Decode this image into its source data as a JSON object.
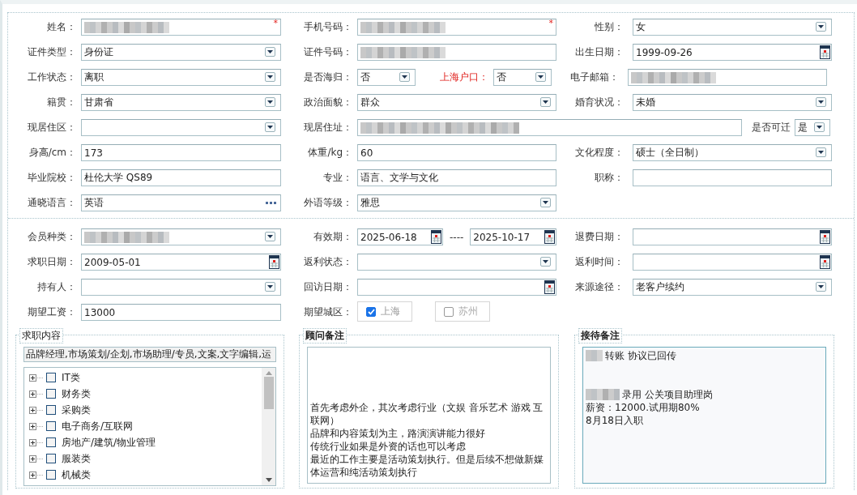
{
  "top_rows": [
    [
      {
        "kind": "field",
        "label": "姓名：",
        "controls": [
          {
            "kind": "text",
            "redacted": true,
            "required_mark": "*"
          }
        ]
      },
      {
        "kind": "field",
        "label": "手机号码：",
        "controls": [
          {
            "kind": "text",
            "redacted": true,
            "required_mark": "*"
          }
        ]
      },
      {
        "kind": "field",
        "label": "性别：",
        "controls": [
          {
            "kind": "select",
            "value": "女"
          }
        ]
      }
    ],
    [
      {
        "kind": "field",
        "label": "证件类型：",
        "controls": [
          {
            "kind": "select",
            "value": "身份证"
          }
        ]
      },
      {
        "kind": "field",
        "label": "证件号码：",
        "controls": [
          {
            "kind": "text",
            "redacted": true
          }
        ]
      },
      {
        "kind": "field",
        "label": "出生日期：",
        "controls": [
          {
            "kind": "date",
            "value": "1999-09-26"
          }
        ]
      }
    ],
    [
      {
        "kind": "field",
        "label": "工作状态：",
        "controls": [
          {
            "kind": "select",
            "value": "离职"
          }
        ]
      },
      {
        "kind": "pair",
        "label": "是否海归：",
        "sublabel": "上海户口：",
        "sublabel_emphasis": true,
        "controls": [
          {
            "kind": "select",
            "value": "否"
          },
          {
            "kind": "select",
            "value": "否"
          }
        ]
      },
      {
        "kind": "field",
        "label": "电子邮箱：",
        "controls": [
          {
            "kind": "text",
            "redacted": true
          }
        ]
      }
    ],
    [
      {
        "kind": "field",
        "label": "籍贯：",
        "controls": [
          {
            "kind": "select",
            "value": "甘肃省"
          }
        ]
      },
      {
        "kind": "field",
        "label": "政治面貌：",
        "controls": [
          {
            "kind": "select",
            "value": "群众"
          }
        ]
      },
      {
        "kind": "field",
        "label": "婚育状况：",
        "controls": [
          {
            "kind": "select",
            "value": "未婚"
          }
        ]
      }
    ],
    [
      {
        "kind": "field",
        "label": "现居住区：",
        "controls": [
          {
            "kind": "select"
          }
        ]
      },
      {
        "kind": "wide",
        "label": "现居住址：",
        "sublabel": "是否可迁",
        "controls": [
          {
            "kind": "text",
            "redacted": true
          },
          {
            "kind": "select",
            "value": "是"
          }
        ]
      }
    ],
    [
      {
        "kind": "field",
        "label": "身高/cm：",
        "controls": [
          {
            "kind": "text",
            "value": "173"
          }
        ]
      },
      {
        "kind": "field",
        "label": "体重/kg：",
        "controls": [
          {
            "kind": "text",
            "value": "60"
          }
        ]
      },
      {
        "kind": "field",
        "label": "文化程度：",
        "controls": [
          {
            "kind": "select",
            "value": "硕士（全日制）"
          }
        ]
      }
    ],
    [
      {
        "kind": "field",
        "label": "毕业院校：",
        "controls": [
          {
            "kind": "text",
            "value": "杜伦大学 QS89"
          }
        ]
      },
      {
        "kind": "field",
        "label": "专业：",
        "controls": [
          {
            "kind": "text",
            "value": "语言、文学与文化"
          }
        ]
      },
      {
        "kind": "field",
        "label": "职称：",
        "controls": [
          {
            "kind": "text"
          }
        ]
      }
    ],
    [
      {
        "kind": "field",
        "label": "通晓语言：",
        "controls": [
          {
            "kind": "lookup",
            "value": "英语"
          }
        ]
      },
      {
        "kind": "field",
        "label": "外语等级：",
        "controls": [
          {
            "kind": "select",
            "value": "雅思"
          }
        ]
      }
    ]
  ],
  "lower_rows": [
    [
      {
        "kind": "field",
        "label": "会员种类：",
        "controls": [
          {
            "kind": "select",
            "redacted": true
          }
        ]
      },
      {
        "kind": "range",
        "label": "有效期：",
        "separator": "----",
        "controls": [
          {
            "kind": "date",
            "value": "2025-06-18"
          },
          {
            "kind": "date",
            "value": "2025-10-17"
          }
        ]
      },
      {
        "kind": "field",
        "label": "退费日期：",
        "controls": [
          {
            "kind": "date"
          }
        ]
      }
    ],
    [
      {
        "kind": "field",
        "label": "求职日期：",
        "controls": [
          {
            "kind": "date",
            "value": "2009-05-01"
          }
        ]
      },
      {
        "kind": "field",
        "label": "返利状态：",
        "controls": [
          {
            "kind": "select"
          }
        ]
      },
      {
        "kind": "field",
        "label": "返利时间：",
        "controls": [
          {
            "kind": "date"
          }
        ]
      }
    ],
    [
      {
        "kind": "field",
        "label": "持有人：",
        "controls": [
          {
            "kind": "select"
          }
        ]
      },
      {
        "kind": "field",
        "label": "回访日期：",
        "controls": [
          {
            "kind": "date"
          }
        ]
      },
      {
        "kind": "field",
        "label": "来源途径：",
        "controls": [
          {
            "kind": "select",
            "value": "老客户续约"
          }
        ]
      }
    ],
    [
      {
        "kind": "field",
        "label": "期望工资：",
        "controls": [
          {
            "kind": "text",
            "value": "13000"
          }
        ]
      },
      {
        "kind": "choices",
        "label": "期望城区：",
        "options": [
          {
            "label": "上海",
            "checked": true
          },
          {
            "label": "苏州",
            "checked": false
          }
        ]
      }
    ]
  ],
  "job_content": {
    "title": "求职内容",
    "summary": "品牌经理,市场策划/企划,市场助理/专员,文案,文字编辑,运",
    "tree": [
      {
        "label": "IT类",
        "expanded": false,
        "checked": false
      },
      {
        "label": "财务类",
        "expanded": false,
        "checked": false
      },
      {
        "label": "采购类",
        "expanded": false,
        "checked": false
      },
      {
        "label": "电子商务/互联网",
        "expanded": false,
        "checked": false
      },
      {
        "label": "房地产/建筑/物业管理",
        "expanded": false,
        "checked": false
      },
      {
        "label": "服装类",
        "expanded": false,
        "checked": false
      },
      {
        "label": "机械类",
        "expanded": false,
        "checked": false
      }
    ]
  },
  "consultant_notes": {
    "title": "顾问备注",
    "lines": [
      {
        "kind": "blank"
      },
      {
        "kind": "blank"
      },
      {
        "kind": "blank"
      },
      {
        "kind": "blank"
      },
      {
        "kind": "text",
        "text": "首先考虑外企，其次考虑行业（文娱  音乐艺术  游戏  互联网）"
      },
      {
        "kind": "text",
        "text": "品牌和内容策划为主，路演演讲能力很好"
      },
      {
        "kind": "text",
        "text": "传统行业如果是外资的话也可以考虑"
      },
      {
        "kind": "text",
        "text": "最近的工作主要是活动策划执行。但是后续不想做新媒体运营和纯活动策划执行"
      }
    ]
  },
  "reception_notes": {
    "title": "接待备注",
    "lines": [
      {
        "kind": "text",
        "text": "转账  协议已回传",
        "redacted": true
      },
      {
        "kind": "blank"
      },
      {
        "kind": "blank"
      },
      {
        "kind": "text",
        "text": "录用  公关项目助理岗",
        "redacted": true
      },
      {
        "kind": "text",
        "text": "薪资：12000.试用期80%"
      },
      {
        "kind": "text",
        "text": "8月18日入职"
      }
    ]
  }
}
